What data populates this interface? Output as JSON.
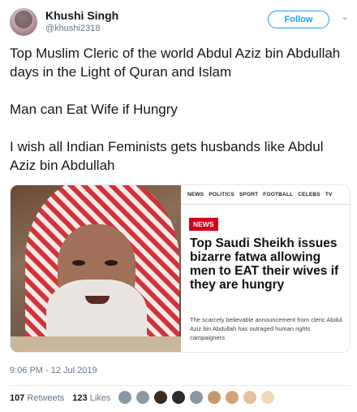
{
  "user": {
    "name": "Khushi Singh",
    "handle": "@khushi2318",
    "follow_label": "Follow",
    "caret": "⌄"
  },
  "tweet": {
    "line1": "Top Muslim Cleric of the world Abdul Aziz bin Abdullah days in the Light of Quran and Islam",
    "line2": "Man can Eat Wife if Hungry",
    "line3": "I wish all Indian Feminists gets husbands like Abdul Aziz bin Abdullah"
  },
  "card": {
    "nav_items": [
      "NEWS",
      "POLITICS",
      "SPORT",
      "FOOTBALL",
      "CELEBS",
      "TV"
    ],
    "badge": "NEWS",
    "headline": "Top Saudi Sheikh issues bizarre fatwa allowing men to EAT their wives if they are hungry",
    "standfirst": "The scarcely believable announcement from cleric Abdul Aziz bin Abdullah has outraged human rights campaigners"
  },
  "meta": {
    "timestamp": "9:06 PM - 12 Jul 2019",
    "retweets_count": "107",
    "retweets_label": "Retweets",
    "likes_count": "123",
    "likes_label": "Likes"
  },
  "colors": {
    "accent": "#1da1f2",
    "badge_red": "#d0021b"
  },
  "liker_colors": [
    "#8899a6",
    "#8899a6",
    "#3a2b1f",
    "#2c2c2c",
    "#8899a6",
    "#c89a6a",
    "#d4a373",
    "#e3c2a0",
    "#f0d9b5"
  ]
}
